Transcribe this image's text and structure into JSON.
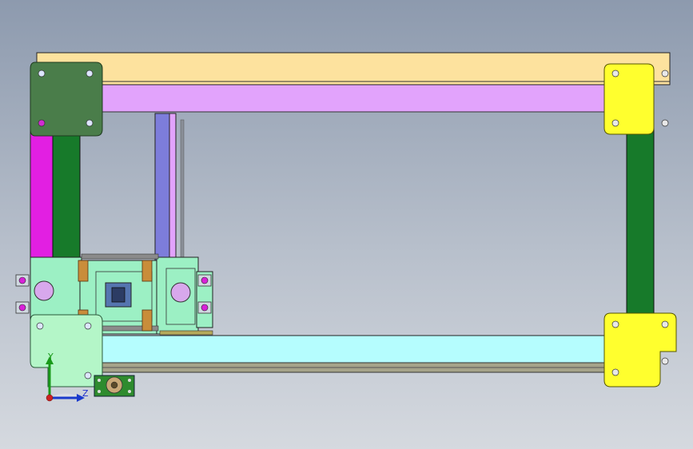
{
  "colors": {
    "background_top": "#8d9aae",
    "background_bottom": "#d5d9df",
    "top_rail": "#fde29e",
    "top_beam": "#e2a3fc",
    "bottom_beam": "#b5fdfe",
    "corner_plate_top_left": "#4a7d4a",
    "corner_plate_right": "#ffff2e",
    "corner_plate_bottom_left": "#b4f6c8",
    "vertical_post": "#177a2a",
    "left_side_bar": "#e21fe2",
    "linear_guide": "#7d7ddb",
    "carriage": "#9cf0c4",
    "bearing_block": "#c98d3a",
    "motor_mount": "#2e8b2e"
  },
  "icons": {
    "axis_triad": "axis-triad-icon",
    "mounting_hole": "hole-icon",
    "bearing": "bearing-icon",
    "motor": "motor-icon"
  },
  "triad": {
    "y_label": "Y",
    "z_label": "Z"
  }
}
